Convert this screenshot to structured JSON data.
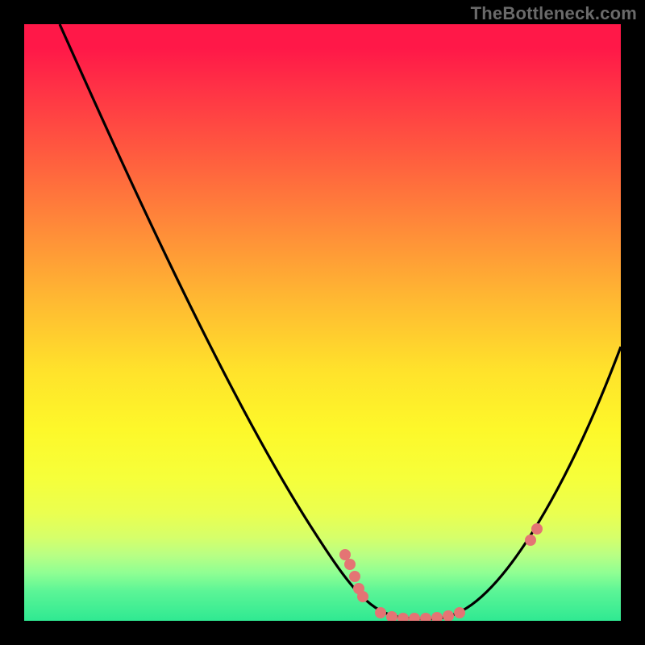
{
  "attribution": "TheBottleneck.com",
  "chart_data": {
    "type": "line",
    "title": "",
    "xlabel": "",
    "ylabel": "",
    "xlim": [
      0,
      100
    ],
    "ylim": [
      0,
      100
    ],
    "series": [
      {
        "name": "bottleneck-curve",
        "x": [
          6,
          12,
          20,
          28,
          36,
          44,
          50,
          54,
          58,
          62,
          66,
          70,
          73,
          76,
          80,
          84,
          88,
          92,
          96,
          100
        ],
        "y": [
          100,
          88,
          72,
          56,
          40,
          24,
          12,
          6,
          2,
          0,
          0,
          0,
          0,
          2,
          6,
          12,
          20,
          30,
          42,
          56
        ]
      }
    ],
    "markers": [
      {
        "name": "left-cluster",
        "x": 54,
        "y": 11
      },
      {
        "name": "left-cluster",
        "x": 55,
        "y": 8
      },
      {
        "name": "left-cluster",
        "x": 56,
        "y": 6
      },
      {
        "name": "left-cluster",
        "x": 57,
        "y": 4
      },
      {
        "name": "bottom-cluster",
        "x": 60,
        "y": 1
      },
      {
        "name": "bottom-cluster",
        "x": 62,
        "y": 0
      },
      {
        "name": "bottom-cluster",
        "x": 64,
        "y": 0
      },
      {
        "name": "bottom-cluster",
        "x": 66,
        "y": 0
      },
      {
        "name": "bottom-cluster",
        "x": 68,
        "y": 0
      },
      {
        "name": "bottom-cluster",
        "x": 70,
        "y": 0
      },
      {
        "name": "bottom-cluster",
        "x": 72,
        "y": 0
      },
      {
        "name": "bottom-cluster",
        "x": 74,
        "y": 1
      },
      {
        "name": "right-cluster",
        "x": 86,
        "y": 14
      },
      {
        "name": "right-cluster",
        "x": 87,
        "y": 16
      }
    ],
    "background": "heatmap-gradient-red-yellow-green"
  },
  "colors": {
    "marker": "#e47474",
    "curve": "#000000",
    "frame_bg": "#000000"
  }
}
